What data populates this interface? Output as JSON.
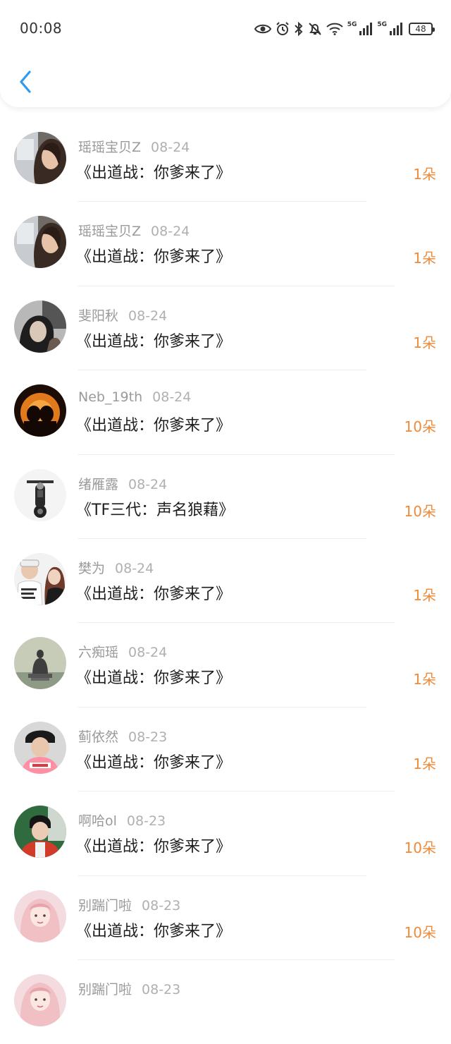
{
  "status_bar": {
    "time": "00:08",
    "net1": "5G",
    "net2": "5G",
    "battery": "48"
  },
  "header": {
    "back_icon": "chevron-left-icon",
    "accent": "#2e9bf0"
  },
  "colors": {
    "amount": "#ef8a3a",
    "meta": "#9a9a9a",
    "divider": "#efefef"
  },
  "items": [
    {
      "user": "瑶瑶宝贝Z",
      "date": "08-24",
      "work": "《出道战：你爹来了》",
      "amount": "1朵",
      "avatar": "girl-train"
    },
    {
      "user": "瑶瑶宝贝Z",
      "date": "08-24",
      "work": "《出道战：你爹来了》",
      "amount": "1朵",
      "avatar": "girl-train"
    },
    {
      "user": "斐阳秋",
      "date": "08-24",
      "work": "《出道战：你爹来了》",
      "amount": "1朵",
      "avatar": "girl-bw"
    },
    {
      "user": "Neb_19th",
      "date": "08-24",
      "work": "《出道战：你爹来了》",
      "amount": "10朵",
      "avatar": "sunset"
    },
    {
      "user": "绪雁露",
      "date": "08-24",
      "work": "《TF三代：声名狼藉》",
      "amount": "10朵",
      "avatar": "motorcycle"
    },
    {
      "user": "樊为",
      "date": "08-24",
      "work": "《出道战：你爹来了》",
      "amount": "1朵",
      "avatar": "couple"
    },
    {
      "user": "六痴瑶",
      "date": "08-24",
      "work": "《出道战：你爹来了》",
      "amount": "1朵",
      "avatar": "buddha"
    },
    {
      "user": "蓟依然",
      "date": "08-23",
      "work": "《出道战：你爹来了》",
      "amount": "1朵",
      "avatar": "boy-cap"
    },
    {
      "user": "啊哈ol",
      "date": "08-23",
      "work": "《出道战：你爹来了》",
      "amount": "10朵",
      "avatar": "boy-red"
    },
    {
      "user": "别踹门啦",
      "date": "08-23",
      "work": "《出道战：你爹来了》",
      "amount": "10朵",
      "avatar": "girl-pink"
    },
    {
      "user": "别踹门啦",
      "date": "08-23",
      "work": "",
      "amount": "",
      "avatar": "girl-pink"
    }
  ]
}
